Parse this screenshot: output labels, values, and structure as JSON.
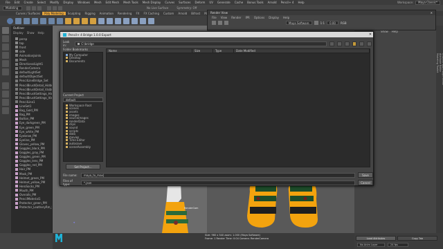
{
  "menubar": {
    "items": [
      "File",
      "Edit",
      "Create",
      "Select",
      "Modify",
      "Display",
      "Windows",
      "Mesh",
      "Edit Mesh",
      "Mesh Tools",
      "Mesh Display",
      "Curves",
      "Surfaces",
      "Deform",
      "UV",
      "Generate",
      "Cache",
      "Bonus Tools",
      "Arnold",
      "Pencil+ 4",
      "Help"
    ],
    "workspace_label": "Workspace:",
    "workspace_value": "Maya Classic*"
  },
  "statusline": {
    "mode": "Modeling",
    "no_live_surface": "No Live Surface",
    "symmetry": "Symmetry: Off"
  },
  "shelf_tabs": {
    "items": [
      "Curves / Surfaces",
      "Poly Modeling",
      "Sculpting",
      "Rigging",
      "Animation",
      "Rendering",
      "FX",
      "FX Caching",
      "Custom",
      "Arnold",
      "Bifrost",
      "MASH",
      "Motion Graphics",
      "XGen",
      "Pencil+ 4"
    ],
    "active_index": 1
  },
  "outliner": {
    "title": "Outliner",
    "menu": [
      "Display",
      "Show",
      "Help"
    ],
    "items": [
      "persp",
      "top",
      "front",
      "side",
      "AnimationJoints",
      "Mesh",
      "DirectionalLight1",
      "RenderCamera",
      "defaultLightSet",
      "defaultObjectSet",
      "PencilLineBridge_Set",
      "PencilBrushDetail_Hidden1",
      "PencilBrushDetail_Visible1",
      "PencilBrushSettings_Hidden1",
      "PencilBrushSettings_Visible1",
      "PencilLine1",
      "LineSet1",
      "Bag_Gold_PM",
      "Bag_PM",
      "Button_PM",
      "Eye_darkgreen_PM",
      "Eye_green_PM",
      "Eye_white_PM",
      "Eyebrow_PM",
      "Eyeline_PM",
      "Gloves_yellow_PM",
      "Goggles_black_PM",
      "Goggles_gray_PM",
      "Goggles_green_PM",
      "Goggles_lens_PM",
      "Goggles_red_PM",
      "Hair_PM",
      "Mask_PM",
      "Helmet_green_PM",
      "Helmet_yellow_PM",
      "HeroSocks_PM",
      "Mouth_PM",
      "Overalls_PM",
      "PencilMaterial1",
      "Protector_green_PM",
      "Protector_LeatheryRm_PM"
    ]
  },
  "render_view": {
    "title": "Render View",
    "menu": [
      "File",
      "View",
      "Render",
      "IPR",
      "Options",
      "Display",
      "Help"
    ],
    "renderer": "Maya Software",
    "value_1": "1:1",
    "value_2": "0.00",
    "value_3": "RGB"
  },
  "right_panel": {
    "menu": [
      "Show",
      "Help"
    ]
  },
  "dialog": {
    "title": "Pencil+ 4 Bridge 1.0.0 Export",
    "close_glyph": "✕",
    "look_in_label": "Look in:",
    "look_in_value": "C:\\bridge",
    "sidebar_title": "Folder Bookmarks",
    "sidebar_items": [
      "My Computer",
      "Desktop",
      "Documents"
    ],
    "current_project_label": "Current Project",
    "current_project_value": "default",
    "project_folders": [
      "Workspace Root",
      "scenes",
      "assets",
      "images",
      "sourceimages",
      "renderData",
      "clips",
      "sound",
      "scripts",
      "data",
      "movies",
      "Time Editor",
      "autosave",
      "sceneAssembly"
    ],
    "set_project_button": "Set Project...",
    "columns": [
      "Name",
      "Size",
      "Type",
      "Date Modified"
    ],
    "file_name_label": "File name:",
    "file_name_value": "maya_to_max|",
    "files_of_type_label": "Files of type:",
    "files_of_type_value": "*.json",
    "save_button": "Save",
    "cancel_button": "Cancel"
  },
  "viewport": {
    "camera_label": "RenderCam",
    "info_lines": [
      "Size: 960 x 540 zoom: 1.000    (Maya Software)",
      "Frame: 1        Render Time: 0:04       Camera: RenderCamera"
    ]
  },
  "attribute_tabs": [
    "Channel Box / Layer Editor",
    "Attribute Editor",
    "Modeling Toolkit"
  ],
  "bottom_right": {
    "load_attributes": "Load Attributes",
    "copy_tab": "Copy Tab",
    "no_anim_layer": "No Anim Layer",
    "fps": "24 fps"
  },
  "colors": {
    "accent": "#e2a23b",
    "shoe": "#f3a30e",
    "maya_logo": "#1fb2d6"
  }
}
